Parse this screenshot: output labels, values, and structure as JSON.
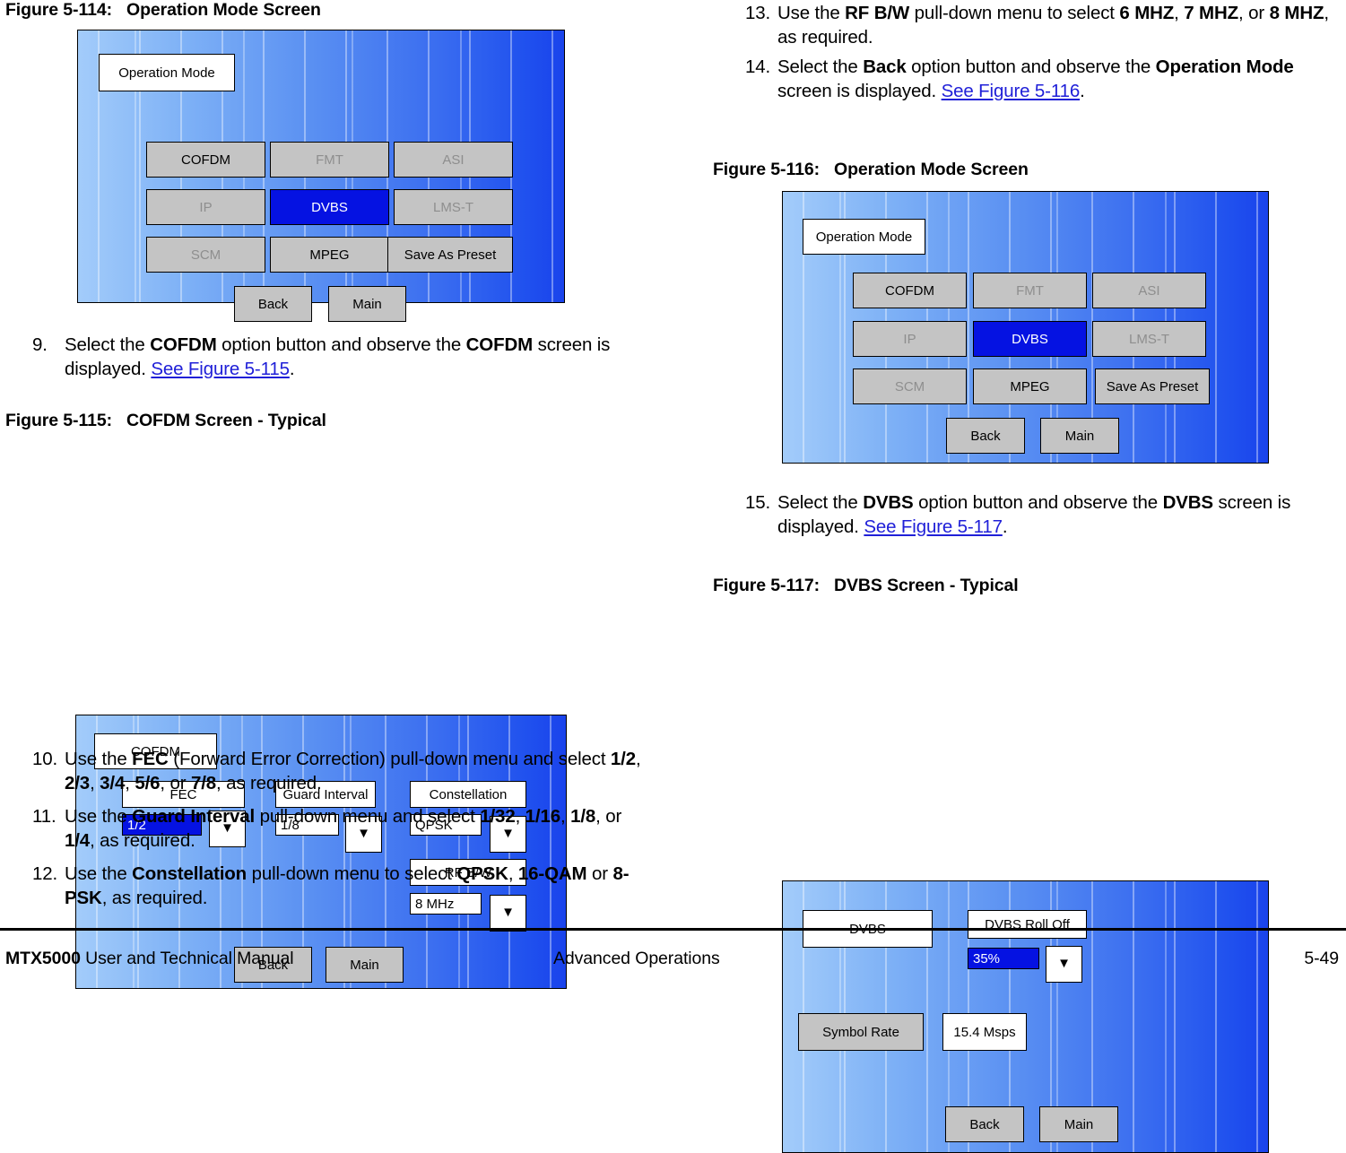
{
  "page": {
    "footer": {
      "left_bold": "MTX5000",
      "left_rest": " User and Technical Manual",
      "center": "Advanced Operations",
      "right": "5-49"
    }
  },
  "left_column": {
    "fig114": {
      "caption_num": "Figure 5-114:",
      "caption_title": "Operation Mode Screen",
      "screen": {
        "title": "Operation Mode",
        "buttons": [
          {
            "label": "COFDM",
            "state": "enabled"
          },
          {
            "label": "FMT",
            "state": "dim"
          },
          {
            "label": "ASI",
            "state": "dim"
          },
          {
            "label": "IP",
            "state": "dim"
          },
          {
            "label": "DVBS",
            "state": "selected"
          },
          {
            "label": "LMS-T",
            "state": "dim"
          },
          {
            "label": "SCM",
            "state": "dim"
          },
          {
            "label": "MPEG",
            "state": "enabled"
          },
          {
            "label": "Save As Preset",
            "state": "enabled"
          }
        ],
        "back": "Back",
        "main": "Main"
      }
    },
    "step9": {
      "num": "9.",
      "t1": "Select the ",
      "b1": "COFDM",
      "t2": " option button and observe the ",
      "b2": "COFDM",
      "t3": " screen is displayed.  ",
      "link": "See Figure 5-115",
      "t4": "."
    },
    "fig115": {
      "caption_num": "Figure 5-115:",
      "caption_title": "COFDM Screen - Typical",
      "screen": {
        "title": "COFDM",
        "fec_label": "FEC",
        "fec_value": "1/2",
        "guard_label": "Guard Interval",
        "guard_value": "1/8",
        "constellation_label": "Constellation",
        "constellation_value": "QPSK",
        "rfbw_label": "RF B/W",
        "rfbw_value": "8 MHz",
        "back": "Back",
        "main": "Main",
        "arrow_glyph": "▼"
      }
    },
    "step10": {
      "num": "10.",
      "t1": "Use the ",
      "b1": "FEC",
      "t2": " (Forward Error Correction) pull-down menu and select ",
      "opts": [
        "1/2",
        "2/3",
        "3/4",
        "5/6",
        "7/8"
      ],
      "t3": ", as required."
    },
    "step11": {
      "num": "11.",
      "t1": "Use the ",
      "b1": "Guard Interval",
      "t2": " pull-down menu and select ",
      "opts": [
        "1/32",
        "1/16",
        "1/8",
        "1/4"
      ],
      "t3": ", as required."
    },
    "step12": {
      "num": "12.",
      "t1": "Use the ",
      "b1": "Constellation",
      "t2": " pull-down menu to select ",
      "opts": [
        "QPSK",
        "16-QAM",
        "8-PSK"
      ],
      "t3": ", as required."
    }
  },
  "right_column": {
    "step13": {
      "num": "13.",
      "t1": "Use the ",
      "b1": "RF B/W",
      "t2": " pull-down menu to select ",
      "opts": [
        "6 MHZ",
        "7 MHZ",
        "8 MHZ"
      ],
      "t3": ", as required."
    },
    "step14": {
      "num": "14.",
      "t1": "Select the ",
      "b1": "Back",
      "t2": " option button and observe the ",
      "b2": "Operation Mode",
      "t3": " screen is displayed. ",
      "link": "See Figure 5-116",
      "t4": "."
    },
    "fig116": {
      "caption_num": "Figure 5-116:",
      "caption_title": "Operation Mode Screen",
      "screen": {
        "title": "Operation Mode",
        "buttons": [
          {
            "label": "COFDM",
            "state": "enabled"
          },
          {
            "label": "FMT",
            "state": "dim"
          },
          {
            "label": "ASI",
            "state": "dim"
          },
          {
            "label": "IP",
            "state": "dim"
          },
          {
            "label": "DVBS",
            "state": "selected"
          },
          {
            "label": "LMS-T",
            "state": "dim"
          },
          {
            "label": "SCM",
            "state": "dim"
          },
          {
            "label": "MPEG",
            "state": "enabled"
          },
          {
            "label": "Save As Preset",
            "state": "enabled"
          }
        ],
        "back": "Back",
        "main": "Main"
      }
    },
    "step15": {
      "num": "15.",
      "t1": "Select the ",
      "b1": "DVBS",
      "t2": " option button and observe the ",
      "b2": "DVBS",
      "t3": " screen is displayed.  ",
      "link": "See Figure 5-117",
      "t4": "."
    },
    "fig117": {
      "caption_num": "Figure 5-117:",
      "caption_title": "DVBS Screen - Typical",
      "screen": {
        "title": "DVBS",
        "rolloff_label": "DVBS Roll Off",
        "rolloff_value": "35%",
        "symbolrate_label": "Symbol Rate",
        "symbolrate_value": "15.4 Msps",
        "back": "Back",
        "main": "Main",
        "arrow_glyph": "▼"
      }
    }
  }
}
